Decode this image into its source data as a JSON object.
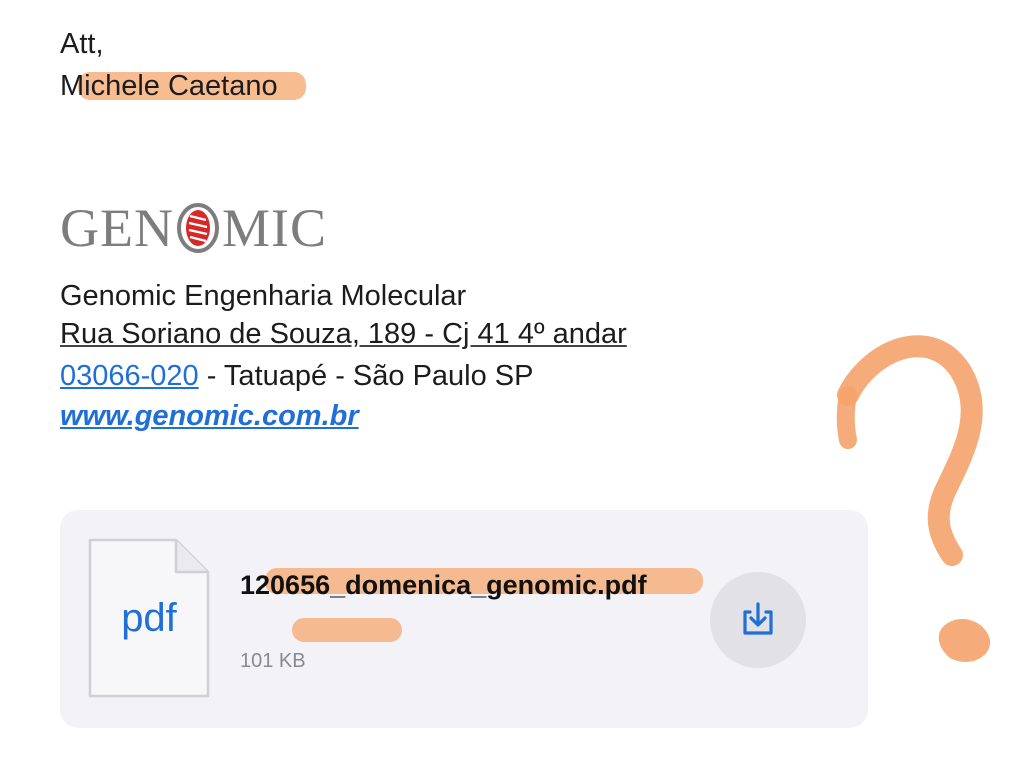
{
  "signature": {
    "closing": "Att,",
    "name": "Michele Caetano"
  },
  "logo": {
    "text_left": "GEN",
    "text_right": "MIC",
    "colors": {
      "text": "#7d7d7d",
      "mark": "#d62828"
    }
  },
  "company": {
    "name": "Genomic Engenharia Molecular",
    "address": "Rua Soriano de Souza, 189 - Cj 41 4º andar",
    "postal_code": "03066-020",
    "city_line": " - Tatuapé - São Paulo SP",
    "website": "www.genomic.com.br"
  },
  "attachment": {
    "file_type": "pdf",
    "file_name": "120656_domenica_genomic.pdf",
    "file_size": "101 KB",
    "download_icon": "download-icon"
  },
  "annotations": {
    "highlight_color": "#f7b07e",
    "question_mark_color": "#f5a36c"
  }
}
